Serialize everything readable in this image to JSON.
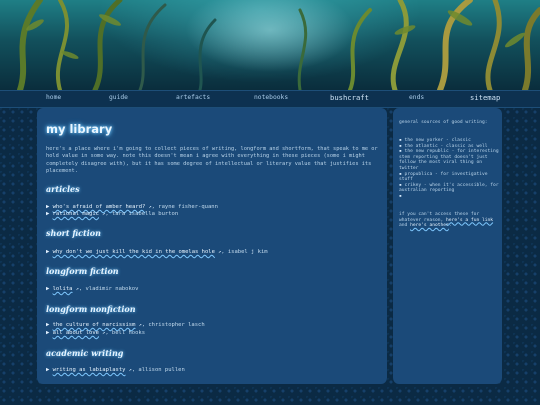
{
  "nav": {
    "home": "home",
    "guide": "guide",
    "artefacts": "artefacts",
    "notebooks": "notebooks",
    "bushcraft": "bushcraft",
    "ends": "ends",
    "sitemap": "sitemap"
  },
  "main": {
    "title": "my library",
    "intro": "here's a place where i'm going to collect pieces of writing, longform and shortform, that speak to me or hold value in some way. note this doesn't mean i agree with everything in these pieces (some i might completely disagree with), but it has some degree of intellectual or literary value that justifies its placement.",
    "sections": {
      "articles": "articles",
      "short_fiction": "short fiction",
      "longform_fiction": "longform fiction",
      "longform_nonfiction": "longform nonfiction",
      "academic_writing": "academic writing"
    },
    "items": {
      "a1_link": "who's afraid of amber heard?",
      "a1_author": ", rayne fisher-quann",
      "a2_link": "rational magic",
      "a2_author": ", tara isabella burton",
      "s1_link": "why don't we just kill the kid in the omelas hole",
      "s1_author": ", isabel j kim",
      "f1_link": "lolita",
      "f1_author": ", vladimir nabokov",
      "n1_link": "the culture of narcissism",
      "n1_author": ", christopher lasch",
      "n2_link": "all about love",
      "n2_author": ", bell hooks",
      "w1_link": "writing as labiaplasty",
      "w1_author": ", allison pullen"
    },
    "bullet": "▶",
    "ext_icon": "↗"
  },
  "side": {
    "heading": "general sources of good writing:",
    "sources": [
      "the new yorker - classic",
      "the atlantic - classic as well",
      "the new republic - for interesting stem reporting that doesn't just follow the most viral thing on twitter",
      "propublica - for investigative stuff",
      "crikey - when it's accessible, for australian reporting",
      ""
    ],
    "access_pre": "if you can't access these for whatever reason, ",
    "access_link1": "here's a fun link",
    "access_mid": " and ",
    "access_link2": "here's another",
    "access_post": "."
  },
  "colors": {
    "background": "#0b2a44",
    "panel": "#1b4a79",
    "heading_glow": "#7fd0ff",
    "text": "#b9d4ea"
  }
}
